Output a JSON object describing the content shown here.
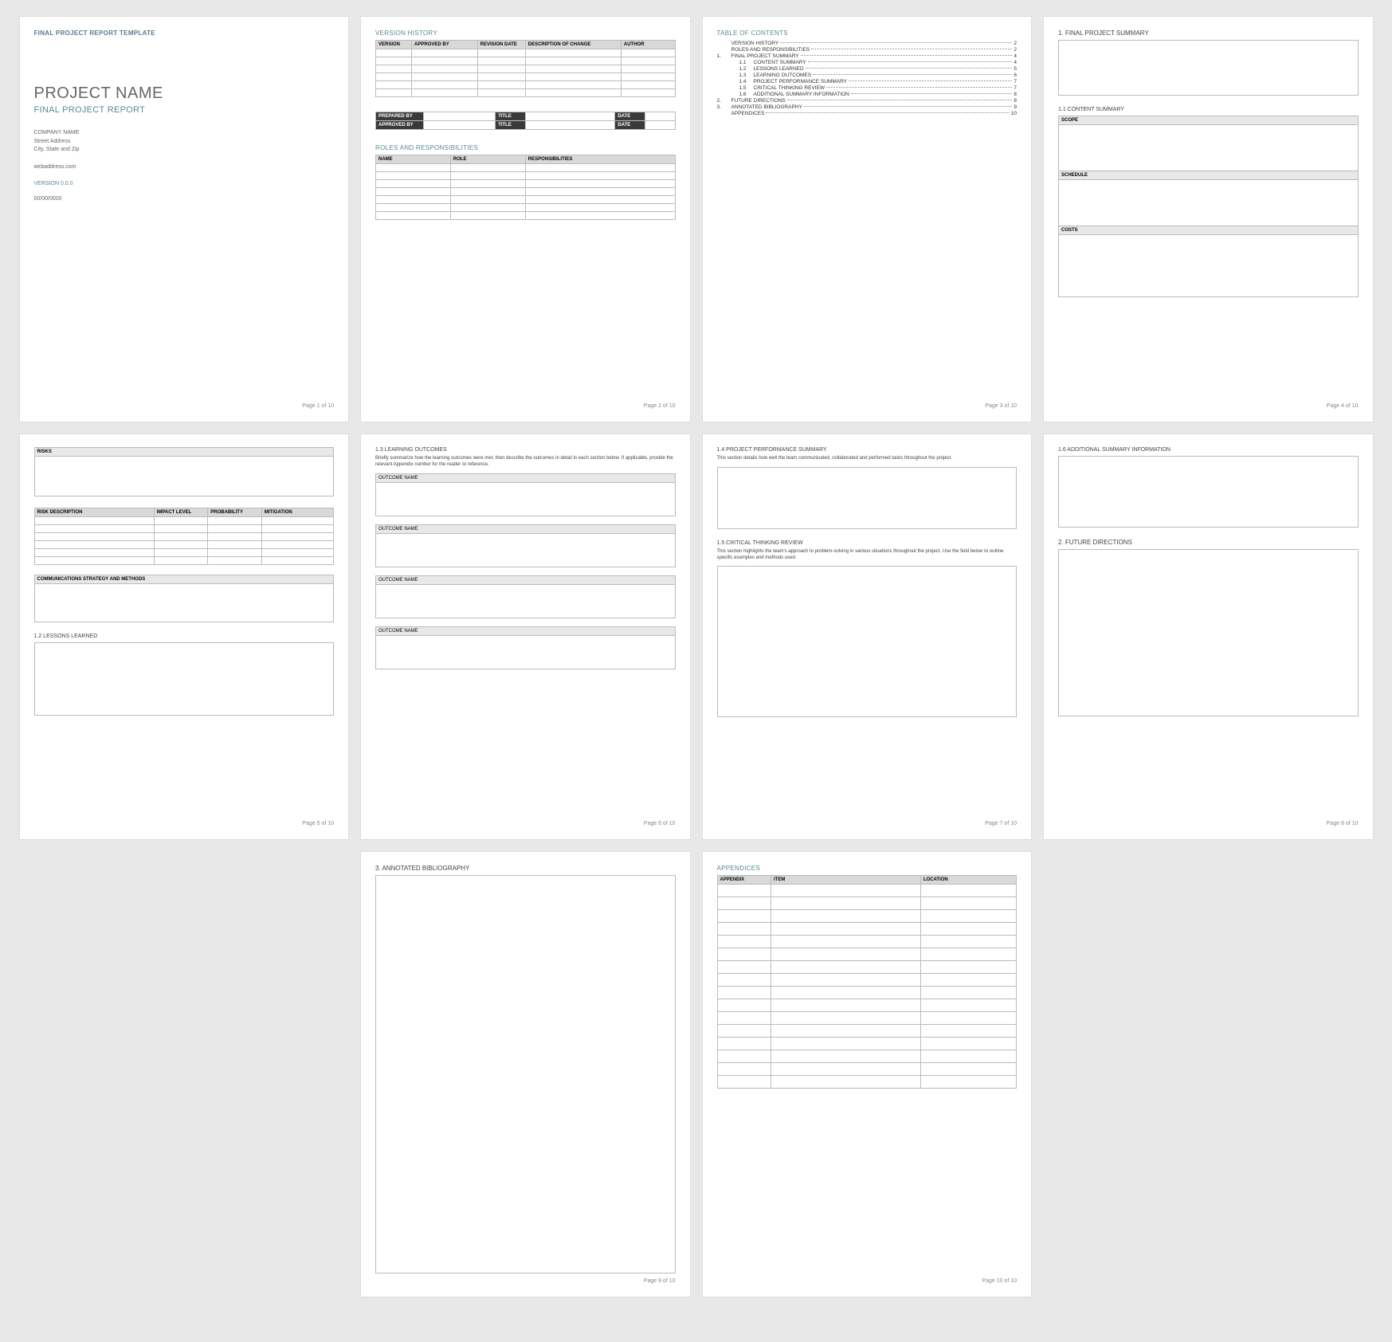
{
  "template_label": "FINAL PROJECT REPORT TEMPLATE",
  "cover": {
    "title": "PROJECT NAME",
    "subtitle": "FINAL PROJECT REPORT",
    "company": "COMPANY NAME",
    "street": "Street Address",
    "city": "City, State and Zip",
    "web": "webaddress.com",
    "version": "VERSION 0.0.0",
    "date": "00/00/0000"
  },
  "p2": {
    "vh": "VERSION HISTORY",
    "vh_cols": [
      "VERSION",
      "APPROVED BY",
      "REVISION DATE",
      "DESCRIPTION OF CHANGE",
      "AUTHOR"
    ],
    "sig": {
      "prep": "PREPARED BY",
      "appr": "APPROVED BY",
      "title": "TITLE",
      "date": "DATE"
    },
    "roles": "ROLES AND RESPONSIBILITIES",
    "roles_cols": [
      "NAME",
      "ROLE",
      "RESPONSIBILITIES"
    ]
  },
  "p3": {
    "heading": "TABLE OF CONTENTS",
    "items": [
      {
        "num": "",
        "title": "VERSION HISTORY",
        "pg": "2"
      },
      {
        "num": "",
        "title": "ROLES AND RESPONSIBILITIES",
        "pg": "2"
      },
      {
        "num": "1.",
        "title": "FINAL PROJECT SUMMARY",
        "pg": "4"
      },
      {
        "num": "1.1",
        "title": "CONTENT SUMMARY",
        "pg": "4",
        "indent": true
      },
      {
        "num": "1.2",
        "title": "LESSONS LEARNED",
        "pg": "5",
        "indent": true
      },
      {
        "num": "1.3",
        "title": "LEARNING OUTCOMES",
        "pg": "6",
        "indent": true
      },
      {
        "num": "1.4",
        "title": "PROJECT PERFORMANCE SUMMARY",
        "pg": "7",
        "indent": true
      },
      {
        "num": "1.5",
        "title": "CRITICAL THINKING REVIEW",
        "pg": "7",
        "indent": true
      },
      {
        "num": "1.6",
        "title": "ADDITIONAL SUMMARY INFORMATION",
        "pg": "8",
        "indent": true
      },
      {
        "num": "2.",
        "title": "FUTURE DIRECTIONS",
        "pg": "8"
      },
      {
        "num": "3.",
        "title": "ANNOTATED BIBLIOGRAPHY",
        "pg": "9"
      },
      {
        "num": "",
        "title": "APPENDICES",
        "pg": "10"
      }
    ]
  },
  "p4": {
    "h1": "1.   FINAL PROJECT SUMMARY",
    "h2": "1.1   CONTENT SUMMARY",
    "scope": "SCOPE",
    "schedule": "SCHEDULE",
    "costs": "COSTS"
  },
  "p5": {
    "risks": "RISKS",
    "risk_cols": [
      "RISK DESCRIPTION",
      "IMPACT LEVEL",
      "PROBABILITY",
      "MITIGATION"
    ],
    "comm": "COMMUNICATIONS STRATEGY AND METHODS",
    "lessons": "1.2   LESSONS LEARNED"
  },
  "p6": {
    "h": "1.3   LEARNING OUTCOMES",
    "intro": "Briefly summarize how the learning outcomes were met, then describe the outcomes in detail in each section below. If applicable, provide the relevant Appendix number for the reader to reference.",
    "label": "OUTCOME NAME"
  },
  "p7": {
    "h1": "1.4   PROJECT PERFORMANCE SUMMARY",
    "t1": "This section details how well the team communicated, collaborated and performed tasks throughout the project.",
    "h2": "1.5   CRITICAL THINKING REVIEW",
    "t2": "This section highlights the team's approach to problem-solving in various situations throughout the project. Use the field below to outline specific examples and methods used."
  },
  "p8": {
    "h1": "1.6   ADDITIONAL SUMMARY INFORMATION",
    "h2": "2.   FUTURE DIRECTIONS"
  },
  "p9": {
    "h": "3.   ANNOTATED BIBLIOGRAPHY"
  },
  "p10": {
    "h": "APPENDICES",
    "cols": [
      "APPENDIX",
      "ITEM",
      "LOCATION"
    ]
  },
  "footer": {
    "p1": "Page 1 of 10",
    "p2": "Page 2 of 10",
    "p3": "Page 3 of 10",
    "p4": "Page 4 of 10",
    "p5": "Page 5 of 10",
    "p6": "Page 6 of 10",
    "p7": "Page 7 of 10",
    "p8": "Page 8 of 10",
    "p9": "Page 9 of 10",
    "p10": "Page 10 of 10"
  }
}
